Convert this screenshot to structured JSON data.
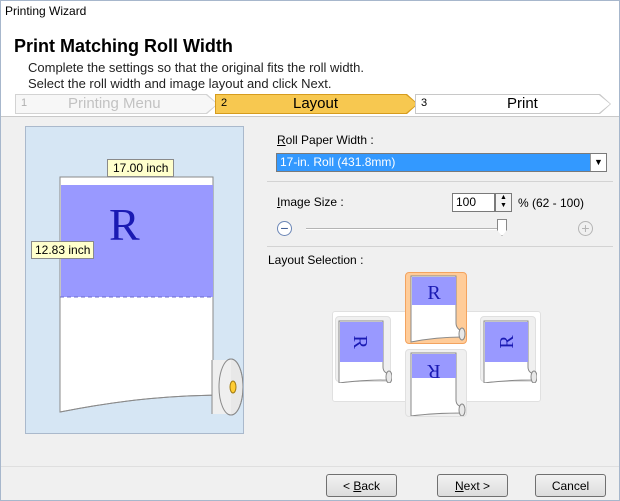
{
  "window": {
    "title": "Printing Wizard"
  },
  "header": {
    "title": "Print Matching Roll Width",
    "description_line1": "Complete the settings so that the original fits the roll width.",
    "description_line2": "Select the roll width and image layout and click Next."
  },
  "steps": [
    {
      "number": "1",
      "label": "Printing Menu",
      "state": "done"
    },
    {
      "number": "2",
      "label": "Layout",
      "state": "current"
    },
    {
      "number": "3",
      "label": "Print",
      "state": "upcoming"
    }
  ],
  "preview": {
    "width_label": "17.00 inch",
    "height_label": "12.83 inch",
    "glyph": "R"
  },
  "roll_paper": {
    "label_accel": "R",
    "label_rest": "oll Paper Width :",
    "selected": "17-in. Roll (431.8mm)"
  },
  "image_size": {
    "label_accel": "I",
    "label_rest": "mage Size :",
    "value": "100",
    "range": "% (62 - 100)",
    "slider_level_percent": 100
  },
  "layout_selection": {
    "label": "Layout Selection :",
    "glyph": "R"
  },
  "footer": {
    "back_label_prefix": "< ",
    "back_label_accel": "B",
    "back_label_rest": "ack",
    "next_label_accel": "N",
    "next_label_rest": "ext >",
    "cancel_label": "Cancel"
  },
  "colors": {
    "selection_blue": "#3399ff",
    "step_active": "#f7c850",
    "preview_bg": "#d6e6f4",
    "image_fill": "#9999ff",
    "layout_selected": "#ffcc99"
  }
}
